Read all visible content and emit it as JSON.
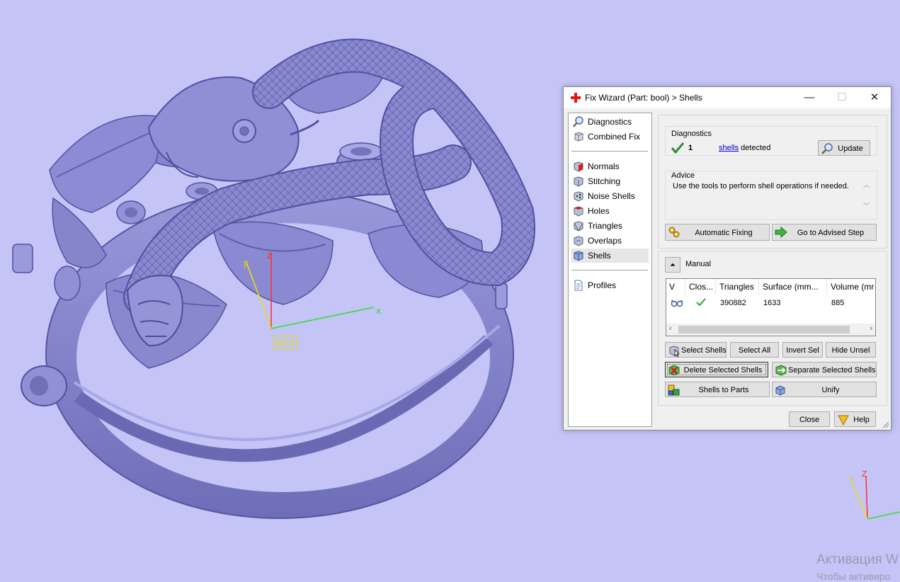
{
  "viewport": {
    "background": "#c4c4f7",
    "model_color": "#8888cc",
    "wcs_label": "WCS",
    "axis": {
      "x": "x",
      "y": "y",
      "z": "z"
    },
    "corner_axis": {
      "y": "Y",
      "z": "Z"
    }
  },
  "dialog": {
    "title": "Fix Wizard (Part: bool) > Shells",
    "controls": {
      "minimize": "—",
      "maximize": "☐",
      "close": "✕"
    },
    "sidebar": {
      "group1": [
        {
          "label": "Diagnostics",
          "icon": "magnifier-icon"
        },
        {
          "label": "Combined Fix",
          "icon": "cube-icon"
        }
      ],
      "group2": [
        {
          "label": "Normals",
          "icon": "normals-cube-icon"
        },
        {
          "label": "Stitching",
          "icon": "stitching-cube-icon"
        },
        {
          "label": "Noise Shells",
          "icon": "noise-shells-icon"
        },
        {
          "label": "Holes",
          "icon": "holes-cube-icon"
        },
        {
          "label": "Triangles",
          "icon": "triangles-icon"
        },
        {
          "label": "Overlaps",
          "icon": "overlaps-icon"
        },
        {
          "label": "Shells",
          "icon": "shells-cube-icon",
          "selected": true
        }
      ],
      "group3": [
        {
          "label": "Profiles",
          "icon": "document-icon"
        }
      ]
    },
    "diagnostics": {
      "title": "Diagnostics",
      "count": "1",
      "link": "shells",
      "suffix": " detected",
      "update_button": "Update"
    },
    "advice": {
      "title": "Advice",
      "text": "Use the tools to perform shell operations if needed."
    },
    "auto_fix_button": "Automatic Fixing",
    "advised_step_button": "Go to Advised Step",
    "manual": {
      "title": "Manual",
      "collapse_icon": "double-chevron-up-icon",
      "table": {
        "headers": [
          "V",
          "Clos...",
          "Triangles",
          "Surface (mm...",
          "Volume (mr"
        ],
        "rows": [
          {
            "visible": "eye-glasses-icon",
            "closed": "check-icon",
            "triangles": "390882",
            "surface": "1633",
            "volume": "885"
          }
        ]
      },
      "buttons": {
        "select_shells": "Select Shells",
        "select_all": "Select All",
        "invert_sel": "Invert Sel",
        "hide_unsel": "Hide Unsel",
        "delete_selected": "Delete Selected Shells",
        "separate_selected": "Separate Selected Shells",
        "shells_to_parts": "Shells to Parts",
        "unify": "Unify"
      }
    },
    "close_button": "Close",
    "help_button": "Help"
  },
  "watermark": {
    "line1": "Активация W",
    "line2": "Чтобы активиро"
  }
}
